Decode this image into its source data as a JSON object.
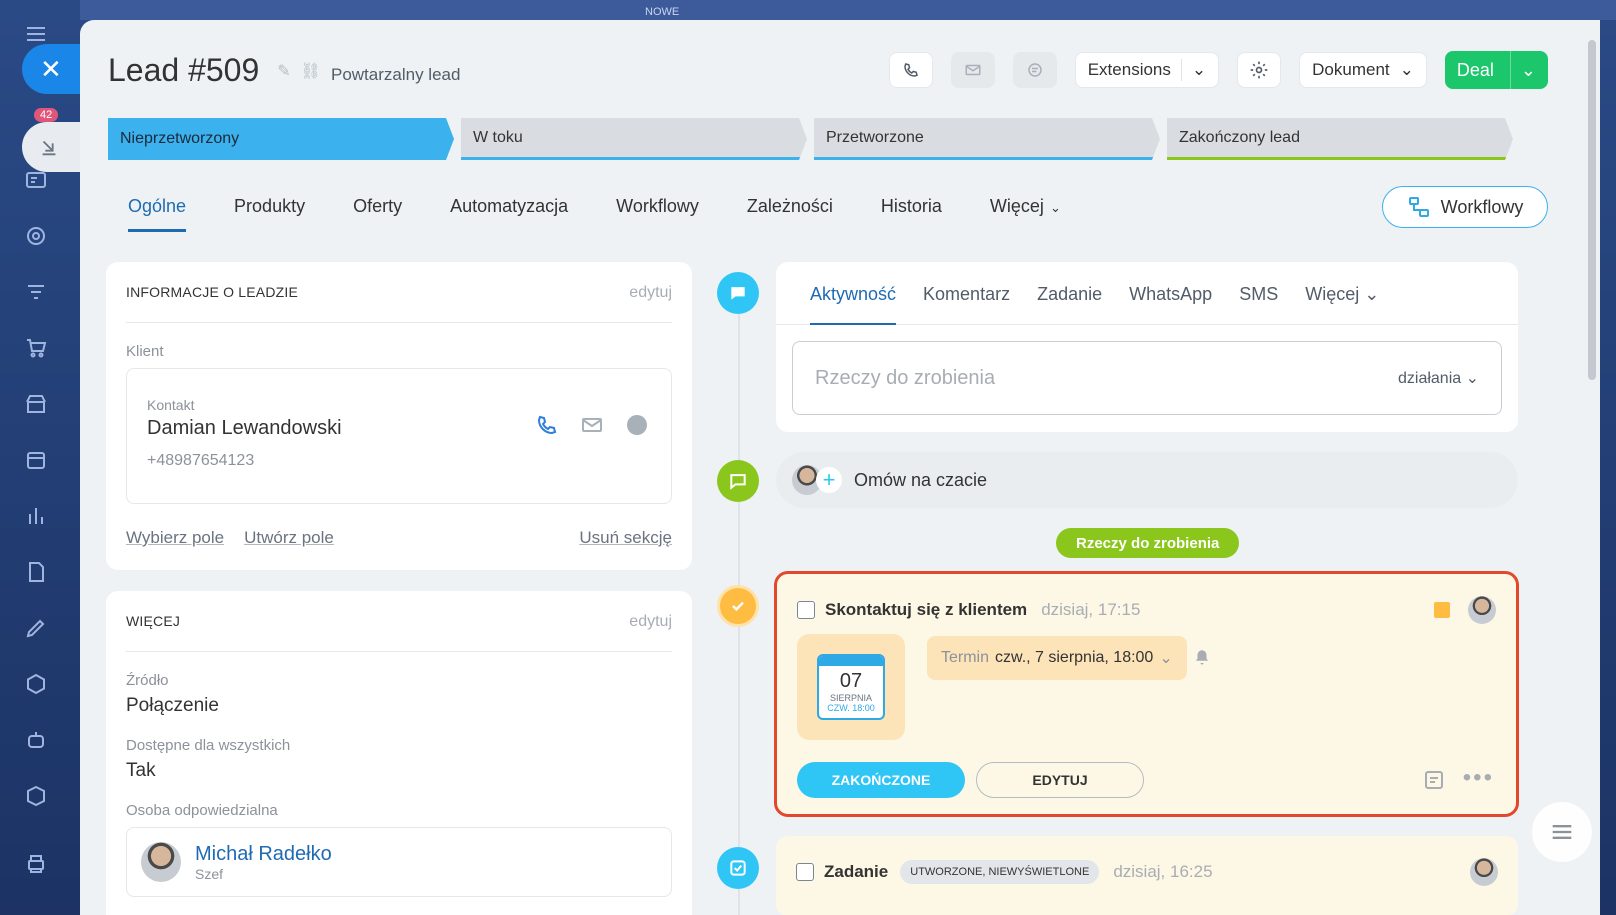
{
  "background": {
    "top_label": "NOWE",
    "badge_count": "42"
  },
  "header": {
    "title": "Lead #509",
    "subtitle": "Powtarzalny lead",
    "extensions_label": "Extensions",
    "document_label": "Dokument",
    "deal_label": "Deal"
  },
  "stages": [
    {
      "label": "Nieprzetworzony"
    },
    {
      "label": "W toku"
    },
    {
      "label": "Przetworzone"
    },
    {
      "label": "Zakończony lead"
    }
  ],
  "tabs": [
    {
      "label": "Ogólne"
    },
    {
      "label": "Produkty"
    },
    {
      "label": "Oferty"
    },
    {
      "label": "Automatyzacja"
    },
    {
      "label": "Workflowy"
    },
    {
      "label": "Zależności"
    },
    {
      "label": "Historia"
    },
    {
      "label": "Więcej"
    }
  ],
  "workflow_button": "Workflowy",
  "lead_info": {
    "title": "INFORMACJE O LEADZIE",
    "edit": "edytuj",
    "client_label": "Klient",
    "contact_kind": "Kontakt",
    "contact_name": "Damian Lewandowski",
    "contact_phone": "+48987654123",
    "select_field": "Wybierz pole",
    "create_field": "Utwórz pole",
    "delete_section": "Usuń sekcję"
  },
  "more_info": {
    "title": "WIĘCEJ",
    "edit": "edytuj",
    "source_label": "Źródło",
    "source_value": "Połączenie",
    "available_label": "Dostępne dla wszystkich",
    "available_value": "Tak",
    "responsible_label": "Osoba odpowiedzialna",
    "responsible_name": "Michał Radełko",
    "responsible_role": "Szef"
  },
  "activity": {
    "tabs": [
      "Aktywność",
      "Komentarz",
      "Zadanie",
      "WhatsApp",
      "SMS",
      "Więcej"
    ],
    "placeholder": "Rzeczy do zrobienia",
    "actions_label": "działania"
  },
  "chat": {
    "label": "Omów na czacie"
  },
  "todo_pill": "Rzeczy do zrobienia",
  "task": {
    "title": "Skontaktuj się z klientem",
    "time": "dzisiaj, 17:15",
    "cal_day": "07",
    "cal_month": "SIERPNIA",
    "cal_time": "CZW. 18:00",
    "deadline_label": "Termin",
    "deadline_value": "czw., 7 sierpnia, 18:00",
    "done_label": "ZAKOŃCZONE",
    "edit_label": "EDYTUJ"
  },
  "task2": {
    "title": "Zadanie",
    "badge": "UTWORZONE, NIEWYŚWIETLONE",
    "time": "dzisiaj, 16:25"
  },
  "colors": {
    "accent": "#3bb1ee",
    "success": "#1cc66b",
    "highlight_border": "#e2482b",
    "todo_green": "#8ac61c"
  }
}
